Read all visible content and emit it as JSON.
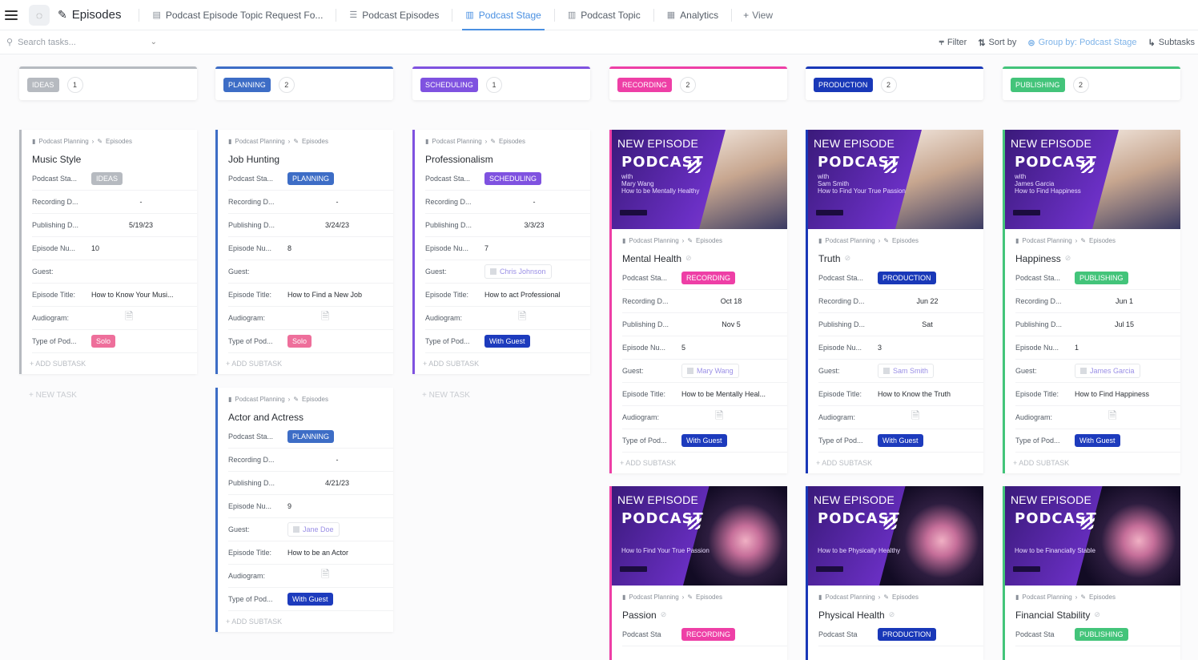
{
  "header": {
    "title": "Episodes",
    "tabs": [
      "Podcast Episode Topic Request Fo...",
      "Podcast Episodes",
      "Podcast Stage",
      "Podcast Topic",
      "Analytics"
    ],
    "active_tab": "Podcast Stage",
    "add_view": "View"
  },
  "toolbar": {
    "search_placeholder": "Search tasks...",
    "filter": "Filter",
    "sort": "Sort by",
    "group": "Group by: Podcast Stage",
    "subtasks": "Subtasks"
  },
  "colors": {
    "ideas": "#b6bac0",
    "planning": "#3d6dc6",
    "scheduling": "#7f52e0",
    "recording": "#ee3fa6",
    "production": "#1938b8",
    "publishing": "#43c47a",
    "solo": "#ee6f9b",
    "with_guest": "#1d3bbd"
  },
  "columns": [
    {
      "key": "ideas",
      "label": "IDEAS",
      "count": "1"
    },
    {
      "key": "planning",
      "label": "PLANNING",
      "count": "2"
    },
    {
      "key": "scheduling",
      "label": "SCHEDULING",
      "count": "1"
    },
    {
      "key": "recording",
      "label": "RECORDING",
      "count": "2"
    },
    {
      "key": "production",
      "label": "PRODUCTION",
      "count": "2"
    },
    {
      "key": "publishing",
      "label": "PUBLISHING",
      "count": "2"
    }
  ],
  "labels": {
    "crumb_a": "Podcast Planning",
    "crumb_b": "Episodes",
    "stage": "Podcast Sta...",
    "recording": "Recording D...",
    "publishing": "Publishing D...",
    "episode_num": "Episode Nu...",
    "guest": "Guest:",
    "episode_title": "Episode Title:",
    "audiogram": "Audiogram:",
    "type": "Type of Pod...",
    "add_subtask": "+ ADD SUBTASK",
    "new_task": "+ NEW TASK",
    "new_episode": "NEW EPISODE",
    "podcast": "PODCAST",
    "partial_stage": "Podcast Sta"
  },
  "cards": {
    "music": {
      "title": "Music Style",
      "stage": "IDEAS",
      "recording": "-",
      "publishing": "5/19/23",
      "num": "10",
      "guest": "",
      "ep_title": "How to Know Your Musi...",
      "type": "Solo"
    },
    "job": {
      "title": "Job Hunting",
      "stage": "PLANNING",
      "recording": "-",
      "publishing": "3/24/23",
      "num": "8",
      "guest": "",
      "ep_title": "How to Find a New Job",
      "type": "Solo"
    },
    "actor": {
      "title": "Actor and Actress",
      "stage": "PLANNING",
      "recording": "-",
      "publishing": "4/21/23",
      "num": "9",
      "guest": "Jane Doe",
      "ep_title": "How to be an Actor",
      "type": "With Guest"
    },
    "prof": {
      "title": "Professionalism",
      "stage": "SCHEDULING",
      "recording": "-",
      "publishing": "3/3/23",
      "num": "7",
      "guest": "Chris Johnson",
      "ep_title": "How to act Professional",
      "type": "With Guest"
    },
    "mental": {
      "title": "Mental Health",
      "stage": "RECORDING",
      "recording": "Oct 18",
      "publishing": "Nov 5",
      "num": "5",
      "guest": "Mary Wang",
      "ep_title": "How to be Mentally Heal...",
      "type": "With Guest",
      "thumb_with": "with",
      "thumb_host": "Mary Wang",
      "thumb_sub": "How to be Mentally Healthy"
    },
    "truth": {
      "title": "Truth",
      "stage": "PRODUCTION",
      "recording": "Jun 22",
      "publishing": "Sat",
      "num": "3",
      "guest": "Sam Smith",
      "ep_title": "How to Know the Truth",
      "type": "With Guest",
      "thumb_with": "with",
      "thumb_host": "Sam Smith",
      "thumb_sub": "How to Find Your True Passion"
    },
    "happy": {
      "title": "Happiness",
      "stage": "PUBLISHING",
      "recording": "Jun 1",
      "publishing": "Jul 15",
      "num": "1",
      "guest": "James Garcia",
      "ep_title": "How to Find Happiness",
      "type": "With Guest",
      "thumb_with": "with",
      "thumb_host": "James Garcia",
      "thumb_sub": "How to Find Happiness"
    },
    "passion": {
      "title": "Passion",
      "stage": "RECORDING",
      "thumb_sub": "How to Find Your True Passion"
    },
    "physical": {
      "title": "Physical Health",
      "stage": "PRODUCTION",
      "thumb_sub": "How to be Physically Healthy"
    },
    "finance": {
      "title": "Financial Stability",
      "stage": "PUBLISHING",
      "thumb_sub": "How to be Financially Stable"
    }
  }
}
